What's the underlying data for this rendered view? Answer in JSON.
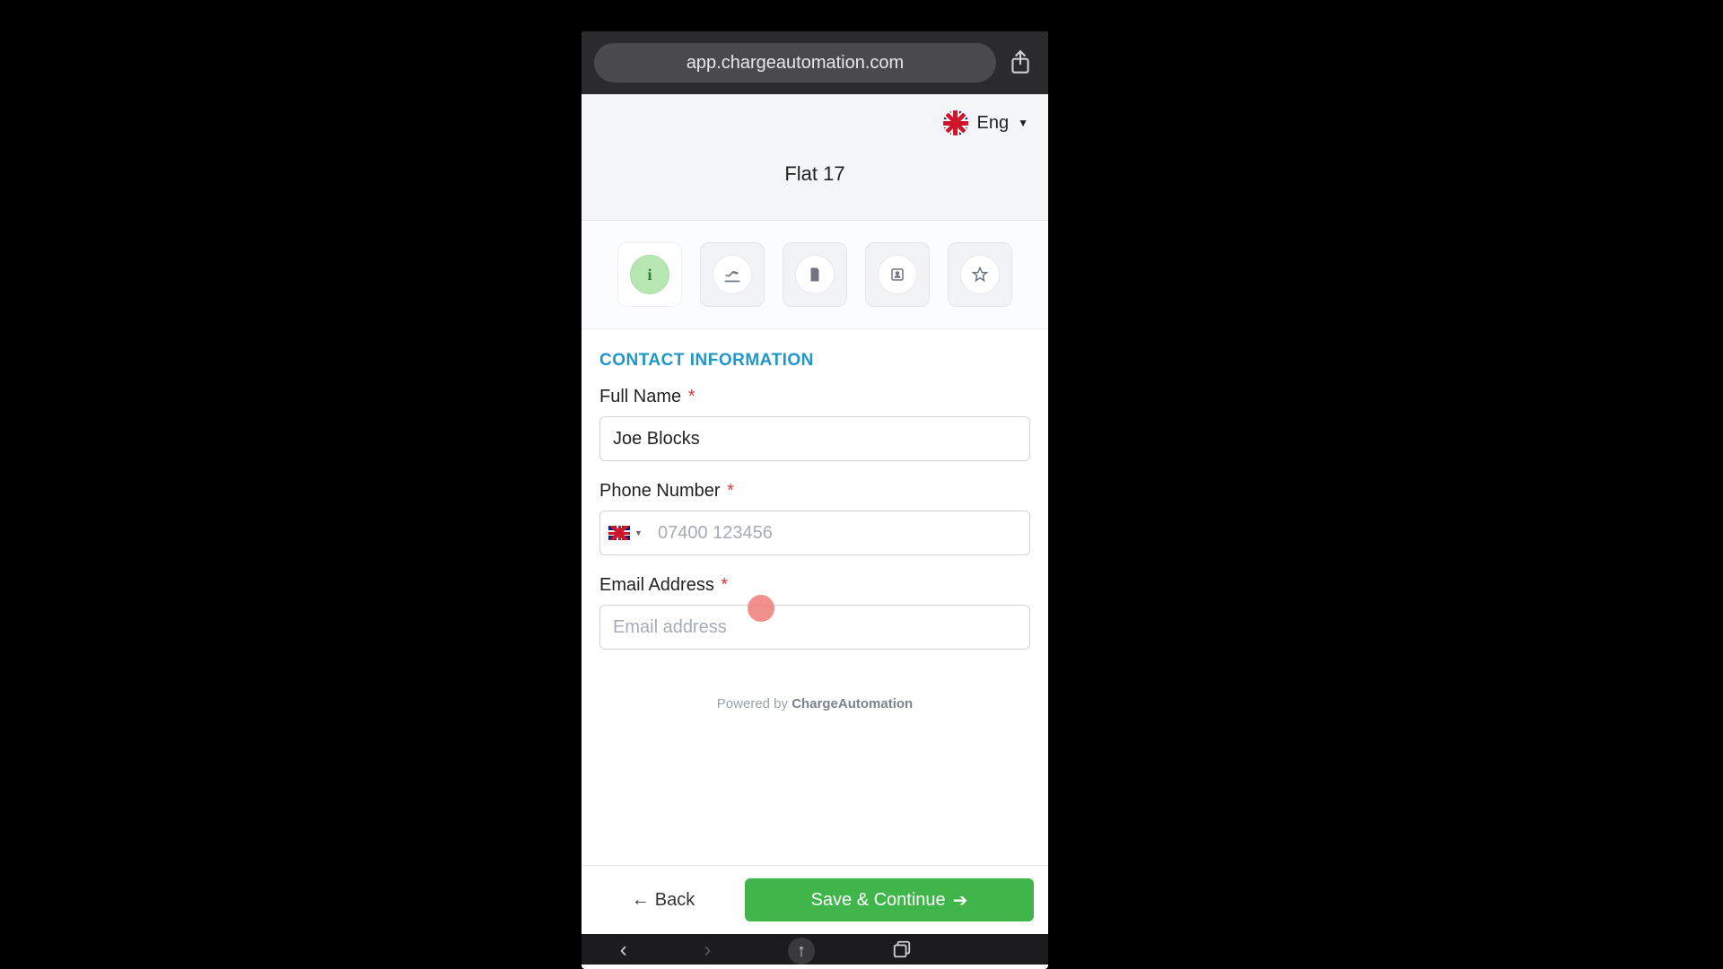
{
  "browser": {
    "url": "app.chargeautomation.com"
  },
  "header": {
    "language_label": "Eng",
    "property_title": "Flat 17"
  },
  "steps": {
    "active_index": 0,
    "icons": [
      "info",
      "arrival",
      "document",
      "id",
      "star"
    ]
  },
  "form": {
    "section_title": "CONTACT INFORMATION",
    "full_name": {
      "label": "Full Name",
      "required": "*",
      "value": "Joe Blocks"
    },
    "phone": {
      "label": "Phone Number",
      "required": "*",
      "placeholder": "07400 123456",
      "value": ""
    },
    "email": {
      "label": "Email Address",
      "required": "*",
      "placeholder": "Email address",
      "value": ""
    }
  },
  "footer": {
    "powered_prefix": "Powered by ",
    "powered_brand": "ChargeAutomation"
  },
  "buttons": {
    "back": "Back",
    "save": "Save & Continue"
  }
}
